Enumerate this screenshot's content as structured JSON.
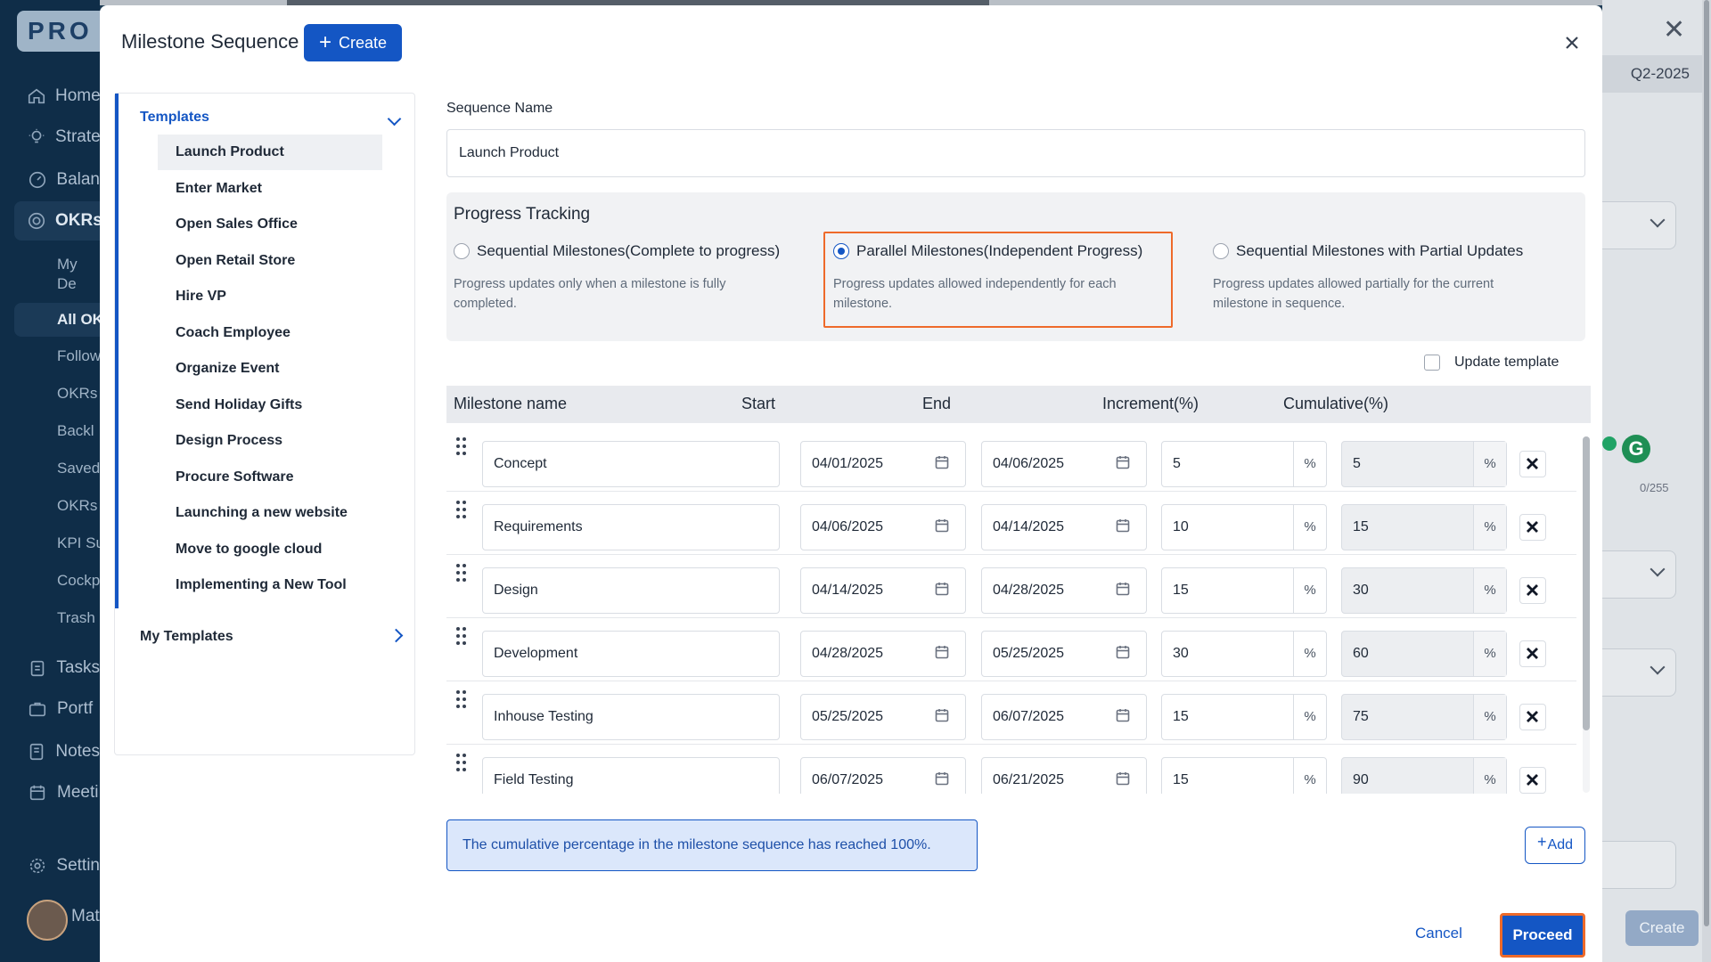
{
  "background": {
    "logo": "PRO",
    "nav": [
      {
        "label": "Home",
        "icon": "home-icon"
      },
      {
        "label": "Strate",
        "icon": "lightbulb-icon"
      },
      {
        "label": "Balan",
        "icon": "gauge-icon"
      },
      {
        "label": "OKRs",
        "icon": "target-icon"
      }
    ],
    "okr_sub": [
      "My De OKRs",
      "All OK",
      "Follow",
      "OKRs",
      "Backl",
      "Saved",
      "OKRs",
      "KPI Su",
      "Cockp",
      "Trash"
    ],
    "nav_bottom": [
      {
        "label": "Tasks",
        "icon": "clipboard-icon"
      },
      {
        "label": "Portf",
        "icon": "briefcase-icon"
      },
      {
        "label": "Notes",
        "icon": "note-icon"
      },
      {
        "label": "Meeti",
        "icon": "calendar-icon"
      },
      {
        "label": "Settin",
        "icon": "gear-icon"
      }
    ],
    "user_name": "Mat",
    "quarter": "Q2-2025",
    "char_counter": "0/255",
    "create_label": "Create"
  },
  "modal": {
    "title": "Milestone Sequence",
    "create_label": "Create",
    "templates": {
      "heading": "Templates",
      "items": [
        "Launch Product",
        "Enter Market",
        "Open Sales Office",
        "Open Retail Store",
        "Hire VP",
        "Coach Employee",
        "Organize Event",
        "Send Holiday Gifts",
        "Design Process",
        "Procure Software",
        "Launching a new website",
        "Move to google cloud",
        "Implementing a New Tool"
      ],
      "selected_index": 0,
      "my_templates": "My Templates"
    },
    "sequence_name_label": "Sequence Name",
    "sequence_name_value": "Launch Product",
    "progress_tracking": {
      "title": "Progress Tracking",
      "options": [
        {
          "label": "Sequential Milestones(Complete to progress)",
          "desc": "Progress updates only when a milestone is fully completed.",
          "checked": false
        },
        {
          "label": "Parallel Milestones(Independent Progress)",
          "desc": "Progress updates allowed independently for each milestone.",
          "checked": true
        },
        {
          "label": "Sequential Milestones with Partial Updates",
          "desc": "Progress updates allowed partially for the current milestone in sequence.",
          "checked": false
        }
      ]
    },
    "update_template_label": "Update template",
    "table": {
      "headers": {
        "name": "Milestone name",
        "start": "Start",
        "end": "End",
        "increment": "Increment(%)",
        "cumulative": "Cumulative(%)"
      },
      "percent_symbol": "%",
      "rows": [
        {
          "name": "Concept",
          "start": "04/01/2025",
          "end": "04/06/2025",
          "increment": "5",
          "cumulative": "5"
        },
        {
          "name": "Requirements",
          "start": "04/06/2025",
          "end": "04/14/2025",
          "increment": "10",
          "cumulative": "15"
        },
        {
          "name": "Design",
          "start": "04/14/2025",
          "end": "04/28/2025",
          "increment": "15",
          "cumulative": "30"
        },
        {
          "name": "Development",
          "start": "04/28/2025",
          "end": "05/25/2025",
          "increment": "30",
          "cumulative": "60"
        },
        {
          "name": "Inhouse Testing",
          "start": "05/25/2025",
          "end": "06/07/2025",
          "increment": "15",
          "cumulative": "75"
        },
        {
          "name": "Field Testing",
          "start": "06/07/2025",
          "end": "06/21/2025",
          "increment": "15",
          "cumulative": "90"
        }
      ]
    },
    "info_message": "The cumulative percentage in the milestone sequence has reached 100%.",
    "add_label": "Add",
    "cancel_label": "Cancel",
    "proceed_label": "Proceed",
    "colors": {
      "primary": "#1456c4",
      "highlight": "#ee6a2a"
    }
  }
}
